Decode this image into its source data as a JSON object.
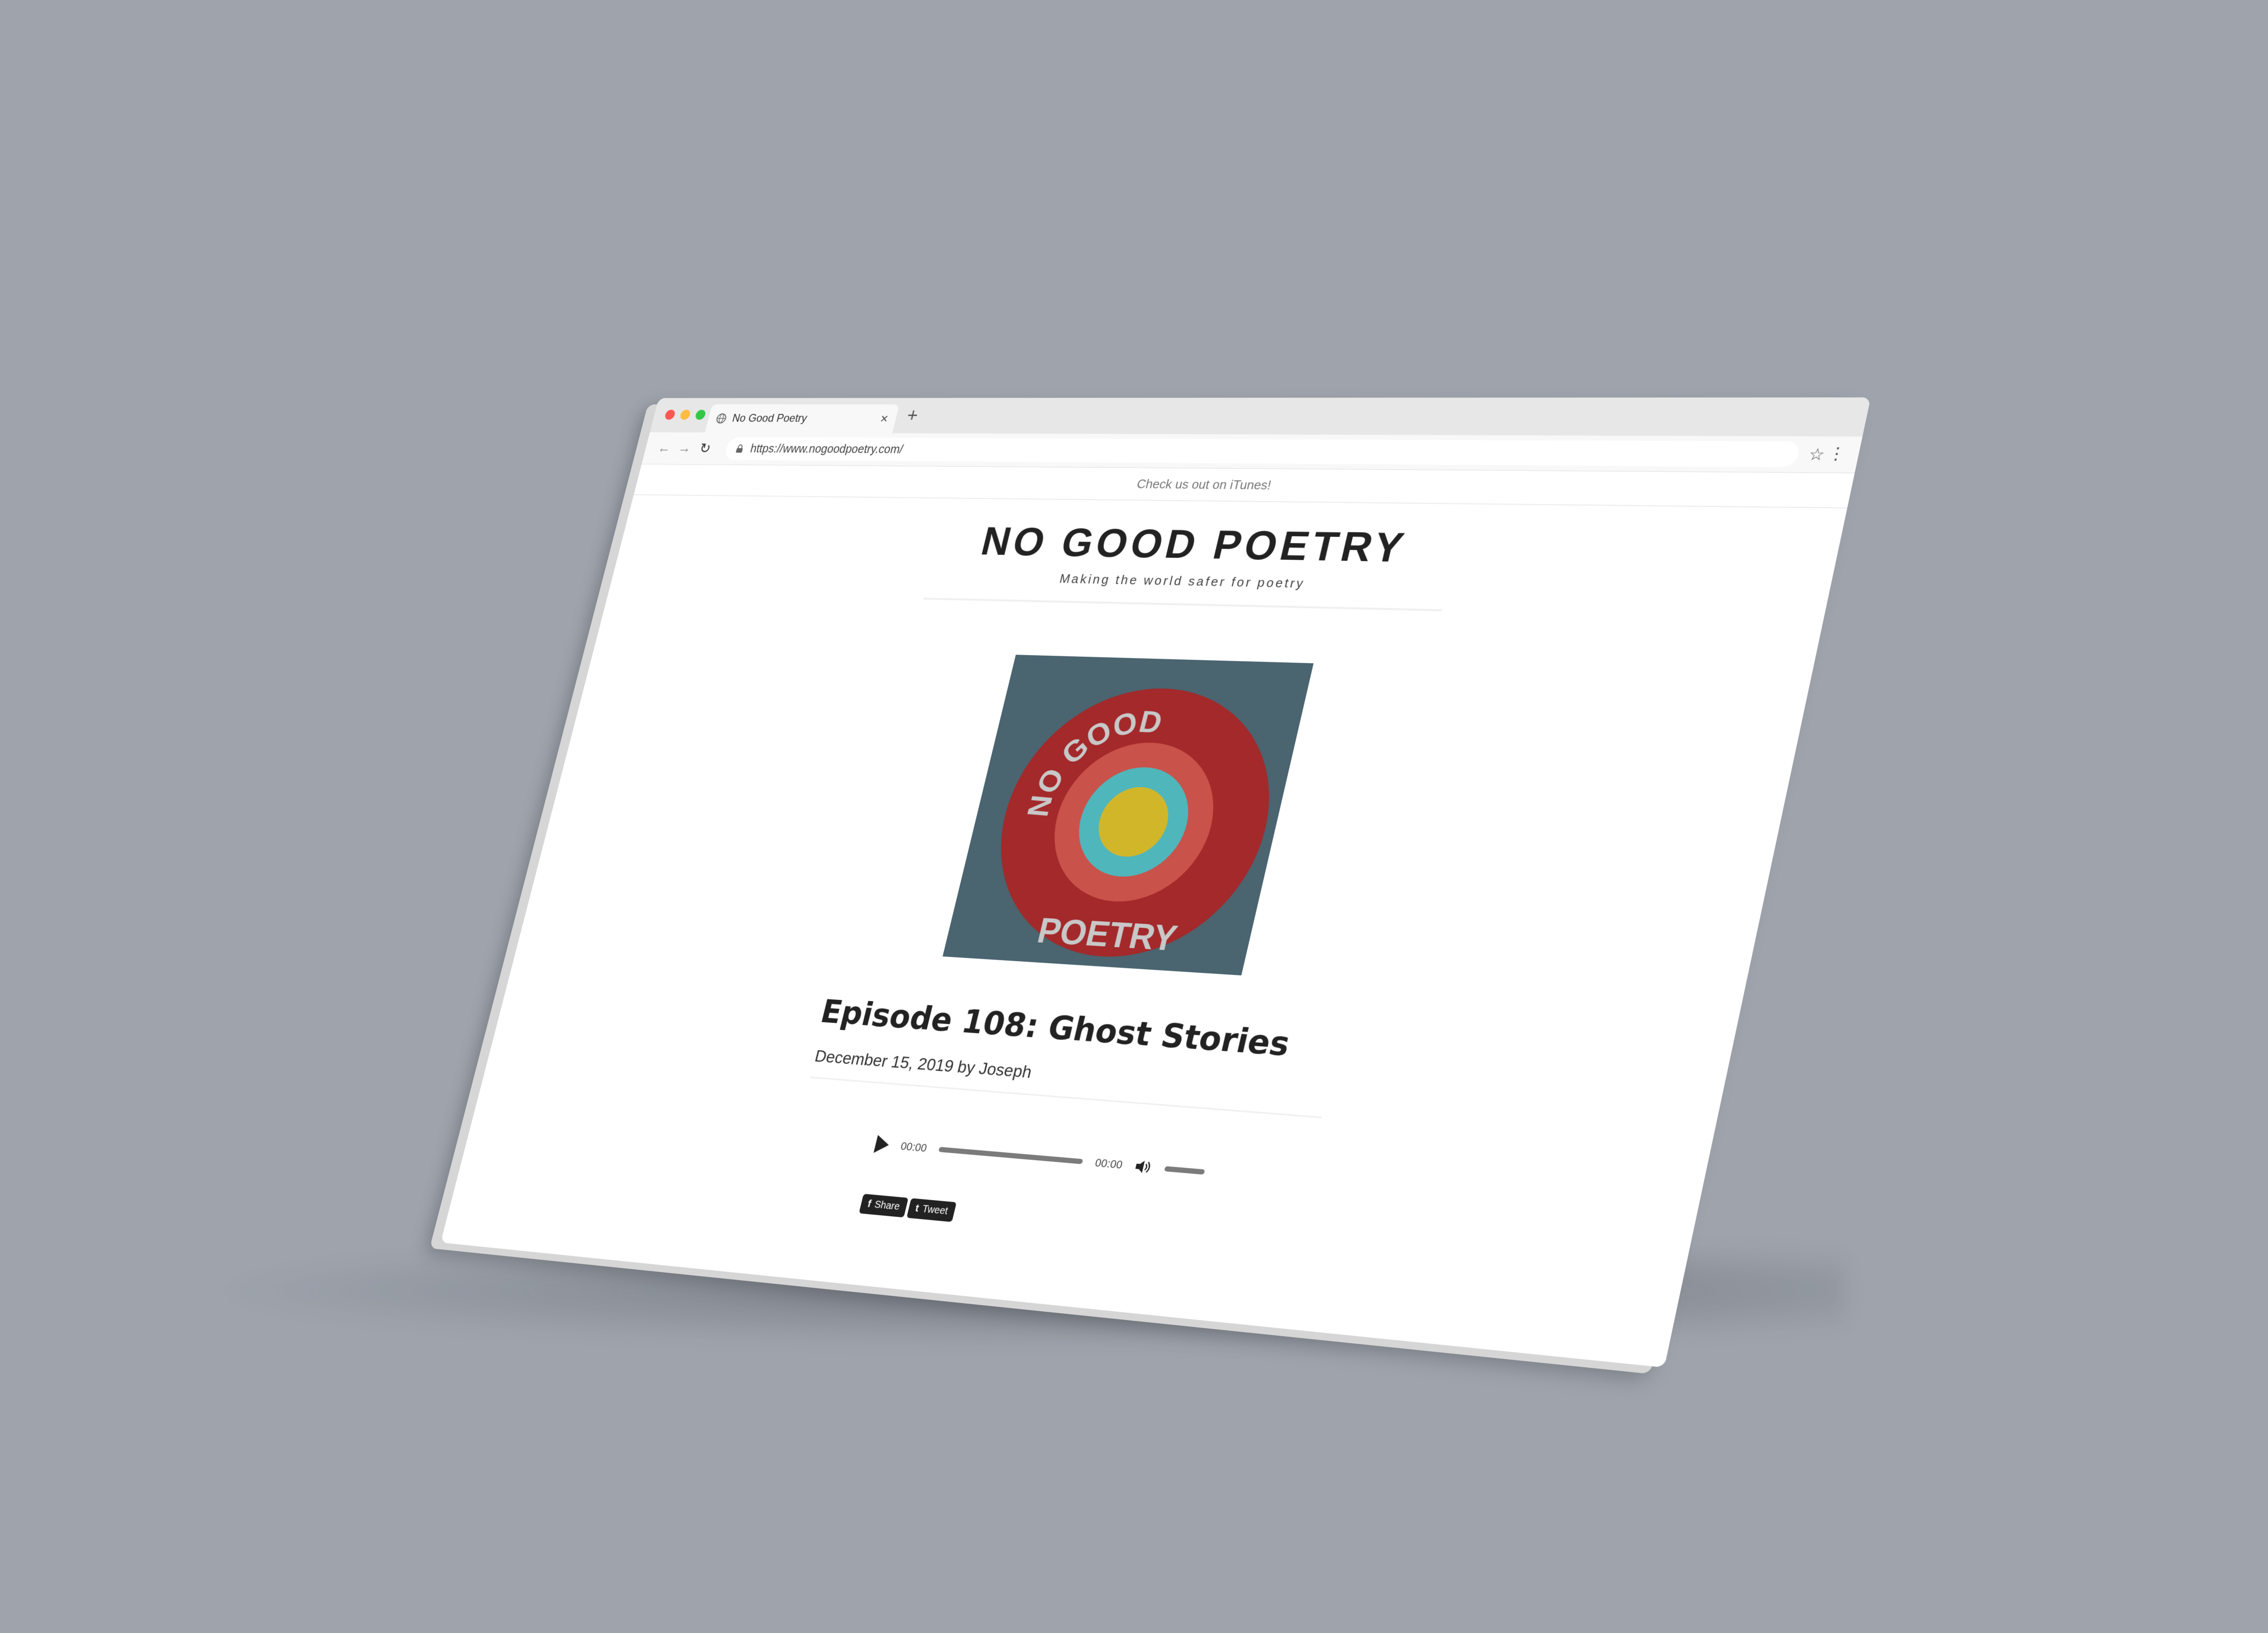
{
  "browser": {
    "tab_title": "No Good Poetry",
    "tab_close": "×",
    "new_tab": "+",
    "url": "https://www.nogoodpoetry.com/",
    "back_glyph": "←",
    "forward_glyph": "→",
    "reload_glyph": "↻",
    "star_glyph": "☆",
    "menu_glyph": "⋮",
    "icons": [
      "globe-icon",
      "lock-icon",
      "back-arrow-icon",
      "forward-arrow-icon",
      "reload-icon",
      "star-icon",
      "menu-kebab-icon"
    ],
    "traffic_light_colors": [
      "#fc5753",
      "#fdbc40",
      "#33c748"
    ]
  },
  "page": {
    "announcement": "Check us out on iTunes!",
    "site_title": "NO GOOD POETRY",
    "tagline": "Making the world safer for poetry",
    "logo": {
      "text_top": "NO GOOD",
      "text_bottom": "POETRY",
      "colors": {
        "background": "#4a6470",
        "outer_ring": "#a3292a",
        "middle_ring": "#c9524a",
        "inner_ring": "#4fb6bb",
        "center": "#d2b62a",
        "text": "#c8c8c8"
      }
    },
    "post": {
      "title": "Episode 108: Ghost Stories",
      "meta": "December 15, 2019 by Joseph"
    },
    "player": {
      "current_time": "00:00",
      "duration": "00:00",
      "progress": 0
    },
    "share": {
      "facebook_glyph": "f",
      "facebook_label": "Share",
      "twitter_glyph": "t",
      "twitter_label": "Tweet"
    }
  }
}
